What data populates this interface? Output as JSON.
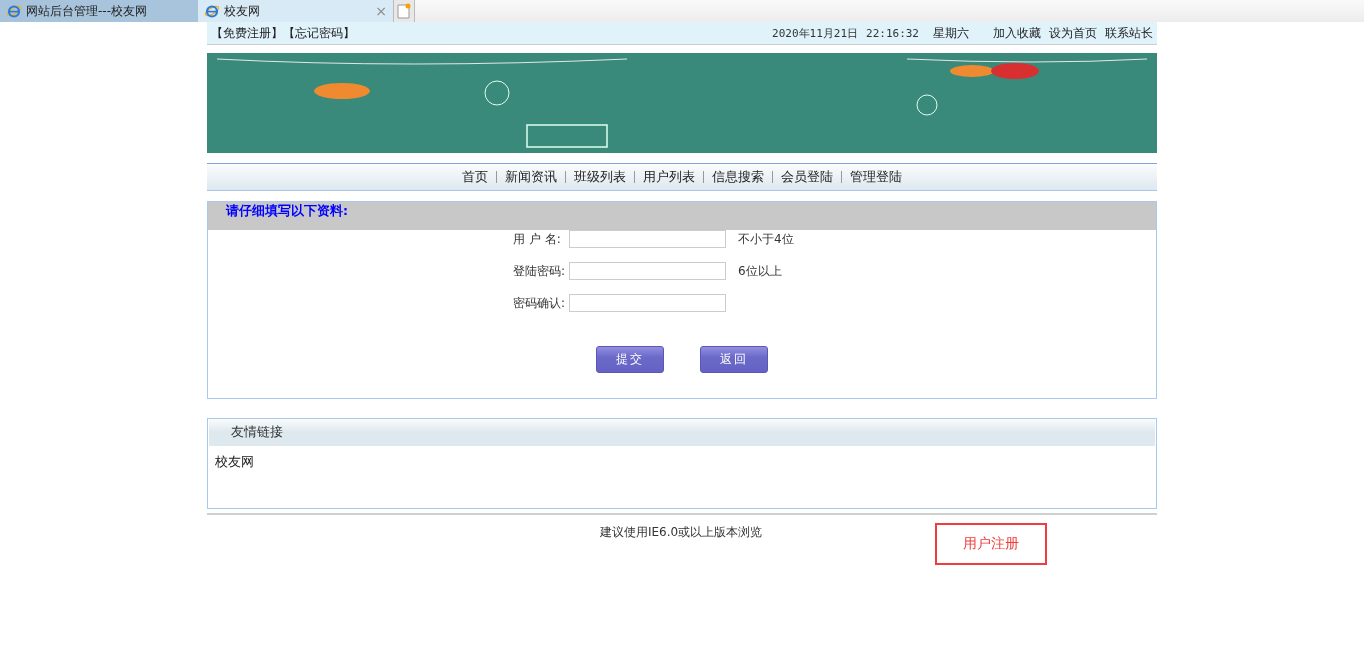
{
  "browser_tabs": [
    {
      "title": "网站后台管理---校友网",
      "selected": false
    },
    {
      "title": "校友网",
      "selected": true,
      "close": "×"
    }
  ],
  "top_bar": {
    "links": [
      "【免费注册】",
      "【忘记密码】"
    ],
    "date": "2020年11月21日",
    "time": "22:16:32",
    "weekday": "星期六",
    "actions": [
      "加入收藏",
      "设为首页",
      "联系站长"
    ]
  },
  "nav": [
    "首页",
    "新闻资讯",
    "班级列表",
    "用户列表",
    "信息搜索",
    "会员登陆",
    "管理登陆"
  ],
  "form": {
    "title": "请仔细填写以下资料:",
    "fields": [
      {
        "label": "用 户 名:",
        "hint": "不小于4位"
      },
      {
        "label": "登陆密码:",
        "hint": "6位以上"
      },
      {
        "label": "密码确认:"
      }
    ],
    "buttons": [
      "提交",
      "返回"
    ]
  },
  "friend_links": {
    "title": "友情链接",
    "links": [
      "校友网"
    ]
  },
  "footer": "建议使用IE6.0或以上版本浏览",
  "annotation": "用户注册"
}
